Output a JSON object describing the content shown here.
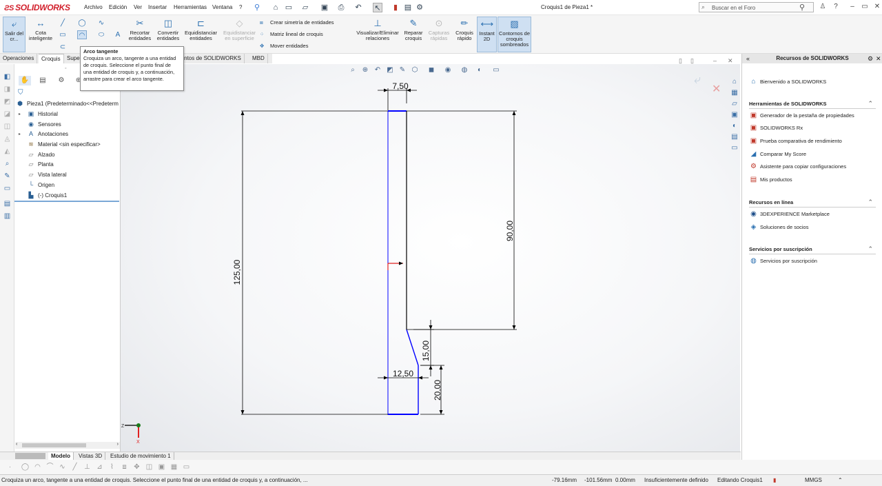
{
  "app": {
    "brand": "SOLIDWORKS",
    "doc_title": "Croquis1 de Pieza1 *"
  },
  "menu": [
    "Archivo",
    "Edición",
    "Ver",
    "Insertar",
    "Herramientas",
    "Ventana"
  ],
  "search": {
    "placeholder": "Buscar en el Foro"
  },
  "commands": {
    "exit_sketch": "Salir del cr...",
    "smart_dim": "Cota inteligente",
    "trim": "Recortar entidades",
    "convert": "Convertir entidades",
    "offset": "Equidistanciar entidades",
    "offset_surface": "Equidistanciar en superficie",
    "mirror": "Crear simetría de entidades",
    "linear_pattern": "Matriz lineal de croquis",
    "move": "Mover entidades",
    "relations": "Visualizar/Eliminar relaciones",
    "repair": "Reparar croquis",
    "quick_captures": "Capturas rápidas",
    "quick_sketch": "Croquis rápido",
    "instant2d": "Instant 2D",
    "shaded": "Contornos de croquis sombreados"
  },
  "tooltip": {
    "title": "Arco tangente",
    "body": "Croquiza un arco, tangente a una entidad de croquis. Seleccione el punto final de una entidad de croquis y, a continuación, arrastre para crear el arco tangente."
  },
  "tabs": [
    "Operaciones",
    "Croquis",
    "Supe",
    "mentos de SOLIDWORKS",
    "MBD"
  ],
  "tree": {
    "root": "Pieza1  (Predeterminado<<Predeterm",
    "items": [
      "Historial",
      "Sensores",
      "Anotaciones",
      "Material <sin especificar>",
      "Alzado",
      "Planta",
      "Vista lateral",
      "Origen",
      "(-) Croquis1"
    ]
  },
  "bottom_tabs": [
    "Modelo",
    "Vistas 3D",
    "Estudio de movimiento 1"
  ],
  "dimensions": {
    "top_width": "7,50",
    "total_height": "125,00",
    "right_height": "90,00",
    "step_height": "15,00",
    "bottom_width": "12,50",
    "bottom_height": "20,00"
  },
  "right_panel": {
    "title": "Recursos de SOLIDWORKS",
    "welcome": "Bienvenido a SOLIDWORKS",
    "sections": [
      {
        "title": "Herramientas de SOLIDWORKS",
        "items": [
          "Generador de la pestaña de propiedades",
          "SOLIDWORKS Rx",
          "Prueba comparativa de rendimiento",
          "Comparar My Score",
          "Asistente para copiar configuraciones",
          "Mis productos"
        ]
      },
      {
        "title": "Recursos en línea",
        "items": [
          "3DEXPERIENCE Marketplace",
          "Soluciones de socios"
        ]
      },
      {
        "title": "Servicios por suscripción",
        "items": [
          "Servicios por suscripción"
        ]
      }
    ]
  },
  "status": {
    "message": "Croquiza un arco, tangente a una entidad de croquis. Seleccione el punto final de una entidad de croquis y, a continuación, ...",
    "x": "-79.16mm",
    "y": "-101.56mm",
    "z": "0.00mm",
    "definition": "Insuficientemente definido",
    "editing": "Editando Croquis1",
    "units": "MMGS"
  },
  "colors": {
    "accent": "#2a6fb0",
    "brand": "#d21f2b",
    "sketch_blue": "#0000ff",
    "sketch_black": "#000000"
  }
}
